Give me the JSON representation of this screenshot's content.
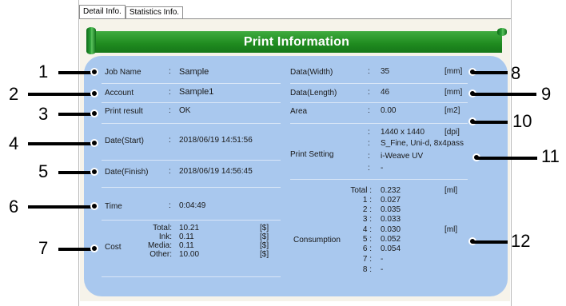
{
  "tabs": [
    "Detail Info.",
    "Statistics Info."
  ],
  "banner_title": "Print Information",
  "colors": {
    "banner_green": "#1f8a1f",
    "card_blue": "#a9c8ee",
    "panel": "#f6f3ea"
  },
  "left": {
    "job_name": {
      "label": "Job Name",
      "value": "Sample"
    },
    "account": {
      "label": "Account",
      "value": "Sample1"
    },
    "print_result": {
      "label": "Print result",
      "value": "OK"
    },
    "date_start": {
      "label": "Date(Start)",
      "value": "2018/06/19 14:51:56"
    },
    "date_finish": {
      "label": "Date(Finish)",
      "value": "2018/06/19 14:56:45"
    },
    "time": {
      "label": "Time",
      "value": "0:04:49"
    },
    "cost": {
      "label": "Cost",
      "rows": [
        {
          "name": "Total",
          "value": "10.21",
          "unit": "[$]"
        },
        {
          "name": "Ink",
          "value": "0.11",
          "unit": "[$]"
        },
        {
          "name": "Media",
          "value": "0.11",
          "unit": "[$]"
        },
        {
          "name": "Other",
          "value": "10.00",
          "unit": "[$]"
        }
      ]
    }
  },
  "right": {
    "data_width": {
      "label": "Data(Width)",
      "value": "35",
      "unit": "[mm]"
    },
    "data_length": {
      "label": "Data(Length)",
      "value": "46",
      "unit": "[mm]"
    },
    "area": {
      "label": "Area",
      "value": "0.00",
      "unit": "[m2]"
    },
    "print_setting": {
      "label": "Print Setting",
      "lines": [
        "1440 x 1440",
        "S_Fine, Uni-d, 8x4pass",
        "i-Weave UV",
        "-"
      ],
      "unit": "[dpi]"
    },
    "consumption": {
      "label": "Consumption",
      "rows": [
        {
          "name": "Total",
          "value": "0.232",
          "unit": "[ml]"
        },
        {
          "name": "1",
          "value": "0.027"
        },
        {
          "name": "2",
          "value": "0.035"
        },
        {
          "name": "3",
          "value": "0.033"
        },
        {
          "name": "4",
          "value": "0.030",
          "unit": "[ml]"
        },
        {
          "name": "5",
          "value": "0.052"
        },
        {
          "name": "6",
          "value": "0.054"
        },
        {
          "name": "7",
          "value": "-"
        },
        {
          "name": "8",
          "value": "-"
        }
      ]
    }
  },
  "callouts": [
    "1",
    "2",
    "3",
    "4",
    "5",
    "6",
    "7",
    "8",
    "9",
    "10",
    "11",
    "12"
  ]
}
